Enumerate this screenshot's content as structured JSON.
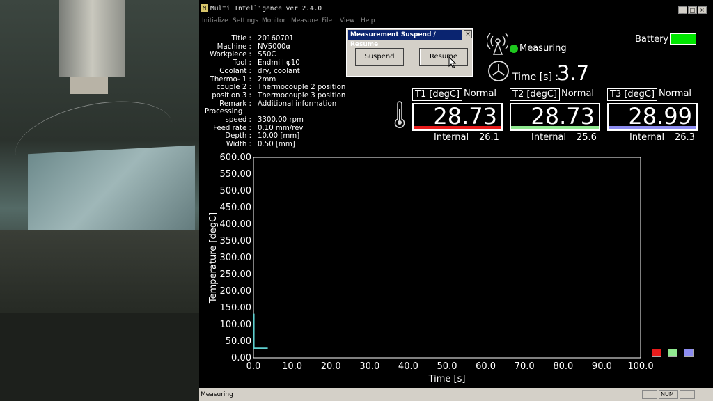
{
  "window": {
    "title": "Multi Intelligence ver 2.4.0",
    "app_icon": "M"
  },
  "menu": [
    "Initialize",
    "Settings",
    "Monitor",
    "Measure",
    "File",
    "View",
    "Help"
  ],
  "info": [
    {
      "label": "Title :",
      "value": "20160701"
    },
    {
      "label": "Machine :",
      "value": "NV5000α"
    },
    {
      "label": "Workpiece :",
      "value": "S50C"
    },
    {
      "label": "Tool :",
      "value": "Endmill φ10"
    },
    {
      "label": "Coolant :",
      "value": "dry, coolant"
    },
    {
      "label": "Thermo- 1 :",
      "value": "2mm"
    },
    {
      "label": "couple  2 :",
      "value": "Thermocouple 2 position"
    },
    {
      "label": "position  3 :",
      "value": "Thermocouple 3 position"
    },
    {
      "label": "Remark :",
      "value": "Additional information"
    },
    {
      "label": "Processing",
      "value": ""
    },
    {
      "label": "speed :",
      "value": "3300.00 rpm"
    },
    {
      "label": "Feed rate :",
      "value": "0.10 mm/rev"
    },
    {
      "label": "Depth :",
      "value": "10.00 [mm]"
    },
    {
      "label": "Width :",
      "value": "0.50 [mm]"
    }
  ],
  "dialog": {
    "title": "Measurement Suspend / Resume",
    "close": "×",
    "suspend": "Suspend",
    "resume": "Resume"
  },
  "status": {
    "measuring": "Measuring",
    "battery": "Battery",
    "time_label": "Time [s] :",
    "time_value": "3.7"
  },
  "channels": [
    {
      "label": "T1 [degC]",
      "state": "Normal",
      "value": "28.73",
      "internal_label": "Internal",
      "internal": "26.1",
      "color": "#e81c1c"
    },
    {
      "label": "T2 [degC]",
      "state": "Normal",
      "value": "28.73",
      "internal_label": "Internal",
      "internal": "25.6",
      "color": "#8fe88f"
    },
    {
      "label": "T3 [degC]",
      "state": "Normal",
      "value": "28.99",
      "internal_label": "Internal",
      "internal": "26.3",
      "color": "#8c8cf0"
    }
  ],
  "statusbar": {
    "text": "Measuring",
    "num": "NUM"
  },
  "colors": {
    "battery": "#00e600",
    "measuring_dot": "#1ec81e",
    "trace": "#5fd0d0"
  },
  "chart_data": {
    "type": "line",
    "xlabel": "Time [s]",
    "ylabel": "Temperature [degC]",
    "xlim": [
      0,
      100
    ],
    "ylim": [
      0,
      600
    ],
    "xticks": [
      "0.0",
      "10.0",
      "20.0",
      "30.0",
      "40.0",
      "50.0",
      "60.0",
      "70.0",
      "80.0",
      "90.0",
      "100.0"
    ],
    "yticks": [
      "0.00",
      "50.00",
      "100.00",
      "150.00",
      "200.00",
      "250.00",
      "300.00",
      "350.00",
      "400.00",
      "450.00",
      "500.00",
      "550.00",
      "600.00"
    ],
    "grid": false,
    "series": [
      {
        "x": [
          0,
          0,
          0.1,
          0.1,
          3.7
        ],
        "y": [
          28.7,
          130,
          130,
          28.7,
          28.7
        ],
        "color": "#5fd0d0"
      }
    ]
  }
}
